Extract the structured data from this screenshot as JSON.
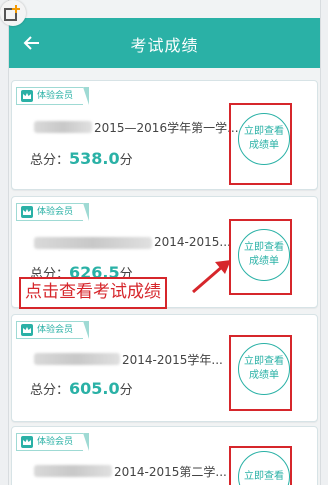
{
  "header": {
    "title": "考试成绩"
  },
  "cards": [
    {
      "badge": "体验会员",
      "exam": "2015—2016学年第一学...",
      "score_label": "总分：",
      "score": "538.0",
      "unit": "分",
      "button_line1": "立即查看",
      "button_line2": "成绩单"
    },
    {
      "badge": "体验会员",
      "exam": "2014-2015...",
      "score_label": "总分：",
      "score": "626.5",
      "unit": "分",
      "button_line1": "立即查看",
      "button_line2": "成绩单"
    },
    {
      "badge": "体验会员",
      "exam": "2014-2015学年...",
      "score_label": "总分：",
      "score": "605.0",
      "unit": "分",
      "button_line1": "立即查看",
      "button_line2": "成绩单"
    },
    {
      "badge": "体验会员",
      "exam": "2014-2015第二学...",
      "button_line1": "立即查看"
    }
  ],
  "annotation": {
    "text": "点击查看考试成绩"
  },
  "colors": {
    "accent": "#2ab1a6",
    "highlight": "#d6262b"
  }
}
